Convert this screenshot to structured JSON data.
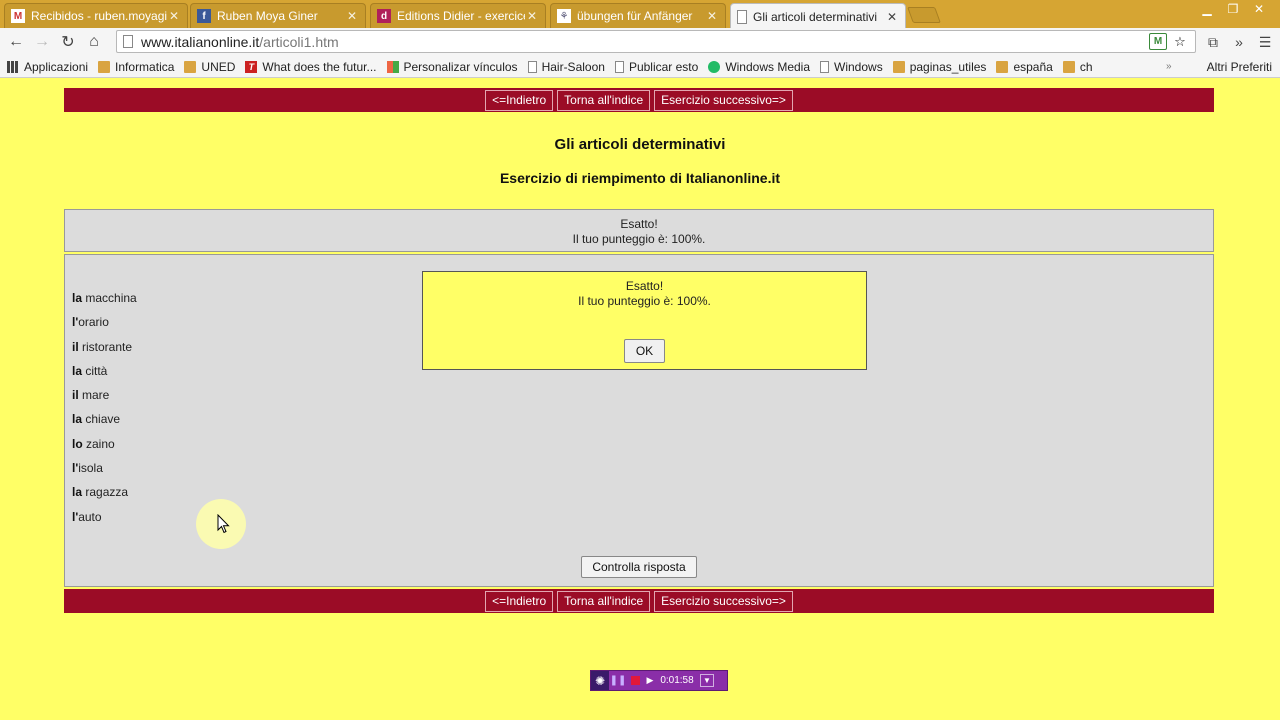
{
  "browser": {
    "tabs": [
      {
        "title": "Recibidos - ruben.moyagiı",
        "favicon": "gmail-icon",
        "active": false
      },
      {
        "title": "Ruben Moya Giner",
        "favicon": "facebook-icon",
        "active": false
      },
      {
        "title": "Editions Didier - exercice:",
        "favicon": "didier-icon",
        "active": false
      },
      {
        "title": "übungen für Anfänger",
        "favicon": "page-icon",
        "active": false
      },
      {
        "title": "Gli articoli determinativi",
        "favicon": "page-icon",
        "active": true
      }
    ],
    "url_host": "www.italianonline.it",
    "url_path": "/articoli1.htm",
    "bookmarks": [
      {
        "label": "Applicazioni",
        "icon": "apps-icon"
      },
      {
        "label": "Informatica",
        "icon": "folder-icon"
      },
      {
        "label": "UNED",
        "icon": "folder-icon"
      },
      {
        "label": "What does the futur...",
        "icon": "t-icon"
      },
      {
        "label": "Personalizar vínculos",
        "icon": "windows-icon"
      },
      {
        "label": "Hair-Saloon",
        "icon": "page-icon"
      },
      {
        "label": "Publicar esto",
        "icon": "page-icon"
      },
      {
        "label": "Windows Media",
        "icon": "windows-media-icon"
      },
      {
        "label": "Windows",
        "icon": "page-icon"
      },
      {
        "label": "paginas_utiles",
        "icon": "folder-icon"
      },
      {
        "label": "españa",
        "icon": "folder-icon"
      },
      {
        "label": "ch",
        "icon": "folder-icon"
      }
    ],
    "bookmarks_more": "»",
    "other_bookmarks": "Altri Preferiti"
  },
  "nav": {
    "back": "<=Indietro",
    "index": "Torna all'indice",
    "next": "Esercizio successivo=>"
  },
  "page": {
    "title": "Gli articoli determinativi",
    "subtitle": "Esercizio di riempimento di Italianonline.it"
  },
  "result": {
    "line1": "Esatto!",
    "line2": "Il tuo punteggio è: 100%."
  },
  "words": [
    {
      "article": "la",
      "rest": " macchina"
    },
    {
      "article": "l'",
      "rest": "orario"
    },
    {
      "article": "il",
      "rest": " ristorante"
    },
    {
      "article": "la",
      "rest": " città"
    },
    {
      "article": "il",
      "rest": " mare"
    },
    {
      "article": "la",
      "rest": " chiave"
    },
    {
      "article": "lo",
      "rest": " zaino"
    },
    {
      "article": "l'",
      "rest": "isola"
    },
    {
      "article": "la",
      "rest": " ragazza"
    },
    {
      "article": "l'",
      "rest": "auto"
    }
  ],
  "check_button": "Controlla risposta",
  "popup": {
    "line1": "Esatto!",
    "line2": "Il tuo punteggio è: 100%.",
    "ok": "OK"
  },
  "recorder": {
    "time": "0:01:58"
  }
}
